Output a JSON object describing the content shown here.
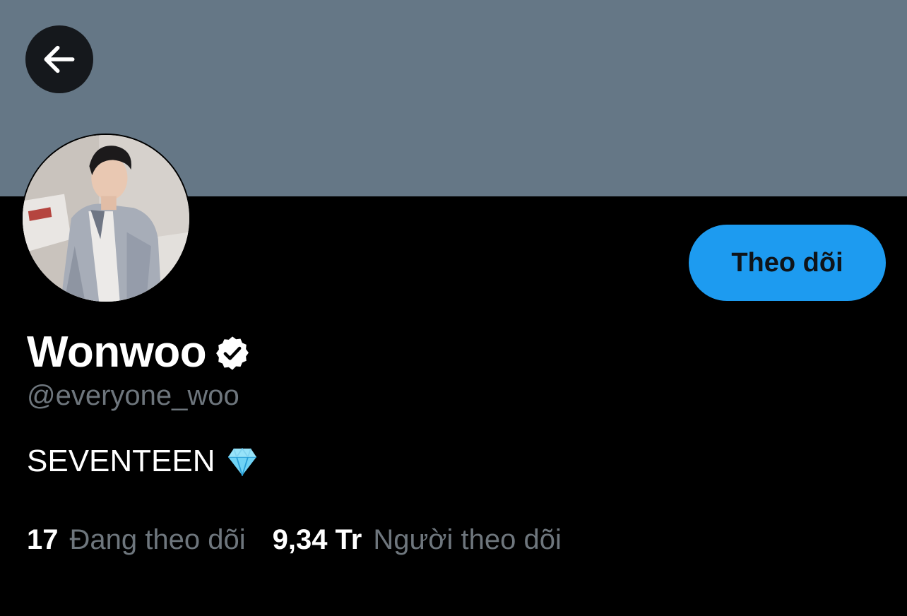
{
  "header": {
    "back_icon": "arrow-left-icon",
    "banner_color": "#657786"
  },
  "profile": {
    "avatar_icon": "profile-photo",
    "display_name": "Wonwoo",
    "verified_icon": "verified-badge-icon",
    "handle": "@everyone_woo",
    "bio_text": "SEVENTEEN",
    "bio_emoji_icon": "gem-icon"
  },
  "actions": {
    "follow_label": "Theo dõi",
    "follow_color": "#1d9bf0"
  },
  "stats": {
    "following_count": "17",
    "following_label": "Đang theo dõi",
    "followers_count": "9,34 Tr",
    "followers_label": "Người theo dõi"
  }
}
